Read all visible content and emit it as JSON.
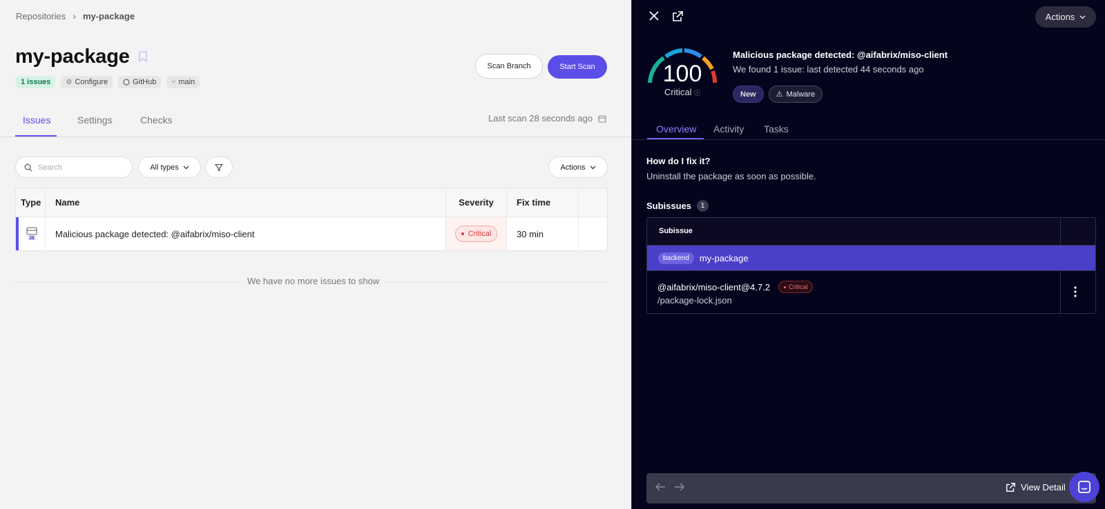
{
  "breadcrumb": {
    "parent": "Repositories",
    "current": "my-package"
  },
  "repo": {
    "title": "my-package",
    "tags": {
      "issues": "1 issues",
      "configure": "Configure",
      "github": "GitHub",
      "branch": "main"
    },
    "scan_branch_label": "Scan Branch",
    "start_scan_label": "Start Scan"
  },
  "tabs": {
    "issues": "Issues",
    "settings": "Settings",
    "checks": "Checks"
  },
  "last_scan": "Last scan 28 seconds ago",
  "toolbar": {
    "search_placeholder": "Search",
    "types_label": "All types",
    "actions_label": "Actions"
  },
  "table": {
    "headers": {
      "type": "Type",
      "name": "Name",
      "severity": "Severity",
      "fix_time": "Fix time"
    },
    "rows": [
      {
        "type_icon": "js-package-icon",
        "name": "Malicious package detected: @aifabrix/miso-client",
        "severity": "Critical",
        "fix_time": "30 min"
      }
    ],
    "empty_message": "We have no more issues to show"
  },
  "detail": {
    "actions_label": "Actions",
    "score": "100",
    "score_label": "Critical",
    "title": "Malicious package detected: @aifabrix/miso-client",
    "subtitle": "We found 1 issue: last detected 44 seconds ago",
    "badges": {
      "new": "New",
      "malware": "Malware"
    },
    "tabs": {
      "overview": "Overview",
      "activity": "Activity",
      "tasks": "Tasks"
    },
    "fix_question": "How do I fix it?",
    "fix_answer": "Uninstall the package as soon as possible.",
    "subissues_label": "Subissues",
    "subissues_count": "1",
    "subissue_header": "Subissue",
    "group": {
      "tag": "backend",
      "name": "my-package"
    },
    "subissue": {
      "package": "@aifabrix/miso-client@4.7.2",
      "severity": "Critical",
      "path": "/package-lock.json"
    },
    "view_detail_label": "View Detail"
  },
  "colors": {
    "accent": "#5b4ee8",
    "critical": "#d63b3b",
    "panel_bg": "#05041d"
  }
}
